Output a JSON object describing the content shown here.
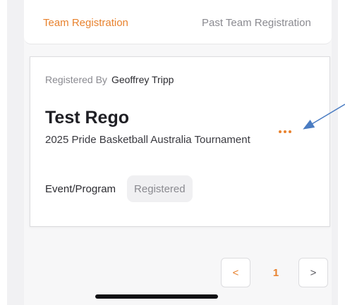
{
  "tabs": [
    {
      "label": "Team Registration",
      "active": true
    },
    {
      "label": "Past Team Registration",
      "active": false
    }
  ],
  "card": {
    "registered_by_label": "Registered By",
    "registered_by_name": "Geoffrey Tripp",
    "team_name": "Test Rego",
    "event_name": "2025 Pride Basketball Australia Tournament",
    "program_label": "Event/Program",
    "status": "Registered",
    "menu_icon": "more-horizontal-icon"
  },
  "pagination": {
    "prev_label": "<",
    "current_page": "1",
    "next_label": ">"
  },
  "colors": {
    "accent": "#e8822e",
    "annotation_arrow": "#4a7cc2"
  }
}
